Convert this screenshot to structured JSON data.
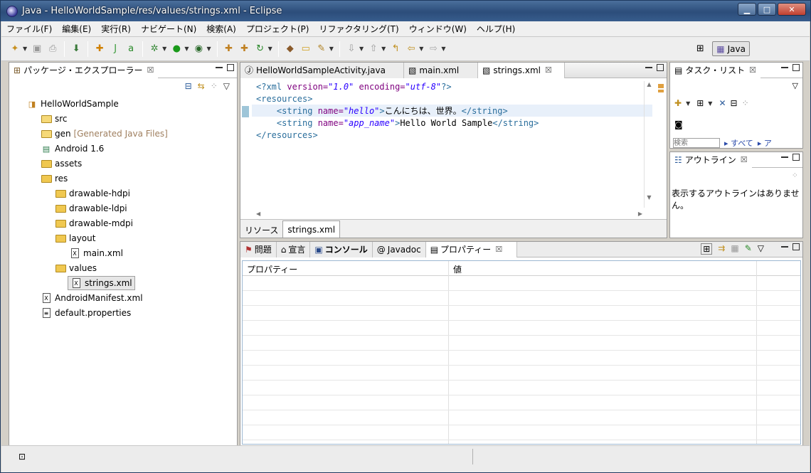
{
  "window": {
    "title": "Java - HelloWorldSample/res/values/strings.xml - Eclipse"
  },
  "menu": [
    "ファイル(F)",
    "編集(E)",
    "実行(R)",
    "ナビゲート(N)",
    "検索(A)",
    "プロジェクト(P)",
    "リファクタリング(T)",
    "ウィンドウ(W)",
    "ヘルプ(H)"
  ],
  "perspective": {
    "label": "Java"
  },
  "package_explorer": {
    "title": "パッケージ・エクスプローラー",
    "items": [
      {
        "label": "HelloWorldSample",
        "icon": "project-icon"
      },
      {
        "label": "src",
        "icon": "folder-icon"
      },
      {
        "label": "gen",
        "extra": "[Generated Java Files]",
        "icon": "folder-icon"
      },
      {
        "label": "Android 1.6",
        "icon": "library-icon"
      },
      {
        "label": "assets",
        "icon": "folder-icon"
      },
      {
        "label": "res",
        "icon": "folder-icon"
      },
      {
        "label": "drawable-hdpi",
        "icon": "folder-icon"
      },
      {
        "label": "drawable-ldpi",
        "icon": "folder-icon"
      },
      {
        "label": "drawable-mdpi",
        "icon": "folder-icon"
      },
      {
        "label": "layout",
        "icon": "folder-icon"
      },
      {
        "label": "main.xml",
        "icon": "xml-file-icon"
      },
      {
        "label": "values",
        "icon": "folder-icon"
      },
      {
        "label": "strings.xml",
        "icon": "xml-file-icon"
      },
      {
        "label": "AndroidManifest.xml",
        "icon": "xml-file-icon"
      },
      {
        "label": "default.properties",
        "icon": "file-icon"
      }
    ]
  },
  "editor": {
    "tabs": [
      "HelloWorldSampleActivity.java",
      "main.xml",
      "strings.xml"
    ],
    "code": {
      "l1_a": "<?xml ",
      "l1_b": "version=",
      "l1_c": "\"1.0\"",
      "l1_d": " encoding=",
      "l1_e": "\"utf-8\"",
      "l1_f": "?>",
      "l2": "<resources>",
      "l3_a": "<string ",
      "l3_b": "name=",
      "l3_c": "\"hello\"",
      "l3_d": ">",
      "l3_e": "こんにちは、世界。",
      "l3_f": "</string>",
      "l4_a": "<string ",
      "l4_b": "name=",
      "l4_c": "\"app_name\"",
      "l4_d": ">",
      "l4_e": "Hello World Sample",
      "l4_f": "</string>",
      "l5": "</resources>"
    },
    "bottom_tabs": [
      "リソース",
      "strings.xml"
    ]
  },
  "task_list": {
    "title": "タスク・リスト",
    "search_placeholder": "検索",
    "filter_all": "▸ すべて",
    "filter_more": "▸ ア"
  },
  "outline": {
    "title": "アウトライン",
    "message": "表示するアウトラインはありません。"
  },
  "bottom_panel": {
    "tabs": [
      "問題",
      "宣言",
      "コンソール",
      "Javadoc",
      "プロパティー"
    ],
    "columns": [
      "プロパティー",
      "値"
    ]
  }
}
